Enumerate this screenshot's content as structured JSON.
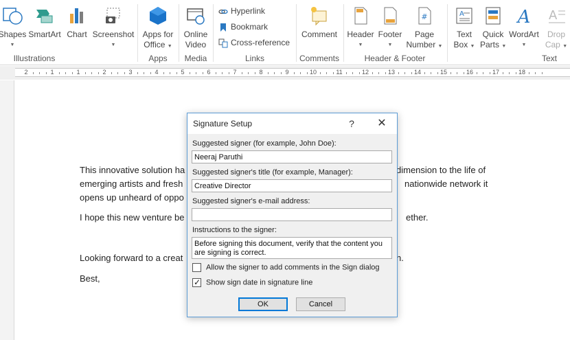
{
  "ribbon": {
    "buttons": {
      "shapes": "Shapes",
      "smartart": "SmartArt",
      "chart": "Chart",
      "screenshot": "Screenshot",
      "apps_line1": "Apps for",
      "apps_line2": "Office",
      "video_line1": "Online",
      "video_line2": "Video",
      "hyperlink": "Hyperlink",
      "bookmark": "Bookmark",
      "cross_reference": "Cross-reference",
      "comment": "Comment",
      "header": "Header",
      "footer": "Footer",
      "page_number_line1": "Page",
      "page_number_line2": "Number",
      "text_box_line1": "Text",
      "text_box_line2": "Box",
      "quick_parts_line1": "Quick",
      "quick_parts_line2": "Parts",
      "wordart": "WordArt",
      "drop_cap_line1": "Drop",
      "drop_cap_line2": "Cap"
    },
    "groups": {
      "illustrations": "Illustrations",
      "apps": "Apps",
      "media": "Media",
      "links": "Links",
      "comments": "Comments",
      "header_footer": "Header & Footer",
      "text": "Text"
    }
  },
  "ruler": {
    "numbers": [
      "2",
      "1",
      "1",
      "2",
      "3",
      "4",
      "5",
      "6",
      "7",
      "8",
      "9",
      "10",
      "11",
      "12",
      "13",
      "14",
      "15",
      "16",
      "17",
      "18"
    ]
  },
  "document": {
    "lines": [
      "This innovative solution ha",
      "dimension to the life of",
      "emerging artists and fresh",
      "nationwide network it",
      "opens up unheard of oppo",
      "I hope this new venture be",
      "ether.",
      "Looking forward to a creat",
      "n.",
      "Best,"
    ]
  },
  "dialog": {
    "title": "Signature Setup",
    "help": "?",
    "close": "✕",
    "signer_label": "Suggested signer (for example, John Doe):",
    "signer_value": "Neeraj Paruthi",
    "title_label": "Suggested signer's title (for example, Manager):",
    "title_value": "Creative Director",
    "email_label": "Suggested signer's e-mail address:",
    "email_value": "",
    "instructions_label": "Instructions to the signer:",
    "instructions_value": "Before signing this document, verify that the content you are signing is correct.",
    "allow_comments_label": "Allow the signer to add comments in the Sign dialog",
    "allow_comments_checked": false,
    "show_date_label": "Show sign date in signature line",
    "show_date_checked": true,
    "ok": "OK",
    "cancel": "Cancel"
  },
  "colors": {
    "accent": "#0078d7",
    "dialog_border": "#5b9bd5",
    "ribbon_icon_blue": "#2b79c2",
    "ribbon_icon_orange": "#e8a33c"
  }
}
